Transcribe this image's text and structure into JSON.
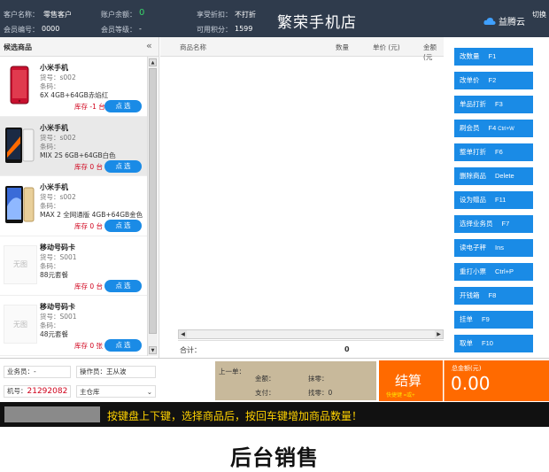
{
  "header": {
    "customer_name_label": "客户名称：",
    "customer_name": "零售客户",
    "balance_label": "账户余额：",
    "balance": "0",
    "discount_label": "享受折扣：",
    "discount": "不打折",
    "member_no_label": "会员编号：",
    "member_no": "0000",
    "member_level_label": "会员等级：",
    "member_level": "-",
    "points_label": "可用积分：",
    "points": "1599",
    "store_name": "繁荣手机店",
    "brand": "益腾云",
    "switch_label": "切换",
    "colors": {
      "bar": "#2f3b4c",
      "accent": "#1a8be6",
      "balance": "#38d46a"
    }
  },
  "product_panel": {
    "title": "候选商品",
    "collapse_icon": "double-chevron-left-icon",
    "items": [
      {
        "name": "小米手机",
        "sku": "货号：s002",
        "barcode": "条码：",
        "desc": "6X 4GB+64GB赤焰红",
        "stock": "库存 -1 台",
        "button": "点 选",
        "thumb": "red-phone",
        "selected": false
      },
      {
        "name": "小米手机",
        "sku": "货号：s002",
        "barcode": "条码：",
        "desc": "MIX 2S 6GB+64GB白色",
        "stock": "库存 0 台",
        "button": "点 选",
        "thumb": "white-phone",
        "selected": true
      },
      {
        "name": "小米手机",
        "sku": "货号：s002",
        "barcode": "条码：",
        "desc": "MAX 2 全网通版 4GB+64GB金色",
        "stock": "库存 0 台",
        "button": "点 选",
        "thumb": "gold-phone",
        "selected": false
      },
      {
        "name": "移动号码卡",
        "sku": "货号：S001",
        "barcode": "条码：",
        "desc": "88元套餐",
        "stock": "库存 0 台",
        "button": "点 选",
        "thumb": "none",
        "thumb_text": "无图",
        "selected": false
      },
      {
        "name": "移动号码卡",
        "sku": "货号：S001",
        "barcode": "条码：",
        "desc": "48元套餐",
        "stock": "库存 0 张",
        "button": "点 选",
        "thumb": "none",
        "thumb_text": "无图",
        "selected": false
      }
    ]
  },
  "grid": {
    "columns": [
      "商品名称",
      "数量",
      "单价 (元)",
      "金额 (元"
    ],
    "total_label": "合计：",
    "total_qty": "0"
  },
  "functions": [
    {
      "label": "改数量",
      "key": "F1"
    },
    {
      "label": "改单价",
      "key": "F2"
    },
    {
      "label": "单品打折",
      "key": "F3"
    },
    {
      "label": "刷会员",
      "key": "F4",
      "key_extra": "Ctrl+W"
    },
    {
      "label": "整单打折",
      "key": "F6"
    },
    {
      "label": "删除商品",
      "key": "Delete"
    },
    {
      "label": "设为赠品",
      "key": "F11"
    },
    {
      "label": "选择业务员",
      "key": "F7"
    },
    {
      "label": "读电子秤",
      "key": "Ins"
    },
    {
      "label": "重打小票",
      "key": "Ctrl+P"
    },
    {
      "label": "开钱箱",
      "key": "F8"
    },
    {
      "label": "挂单",
      "key": "F9"
    },
    {
      "label": "取单",
      "key": "F10"
    }
  ],
  "bottom": {
    "salesperson": "业务员：-",
    "operator": "操作员：王从波",
    "machine_label": "机号：",
    "machine_no": "21292082",
    "warehouse": "主仓库",
    "last_order_label": "上一单：",
    "last_amount_label": "金额：",
    "last_rounding_label": "抹零：",
    "last_paid_label": "支付：",
    "last_change_label": "找零：0",
    "checkout_label": "结算",
    "checkout_hint": "快捷键 =或+",
    "total_label": "总金额(元)",
    "total_value": "0.00"
  },
  "status": {
    "message": "按键盘上下键，选择商品后，按回车键增加商品数量！"
  },
  "caption": "后台销售"
}
